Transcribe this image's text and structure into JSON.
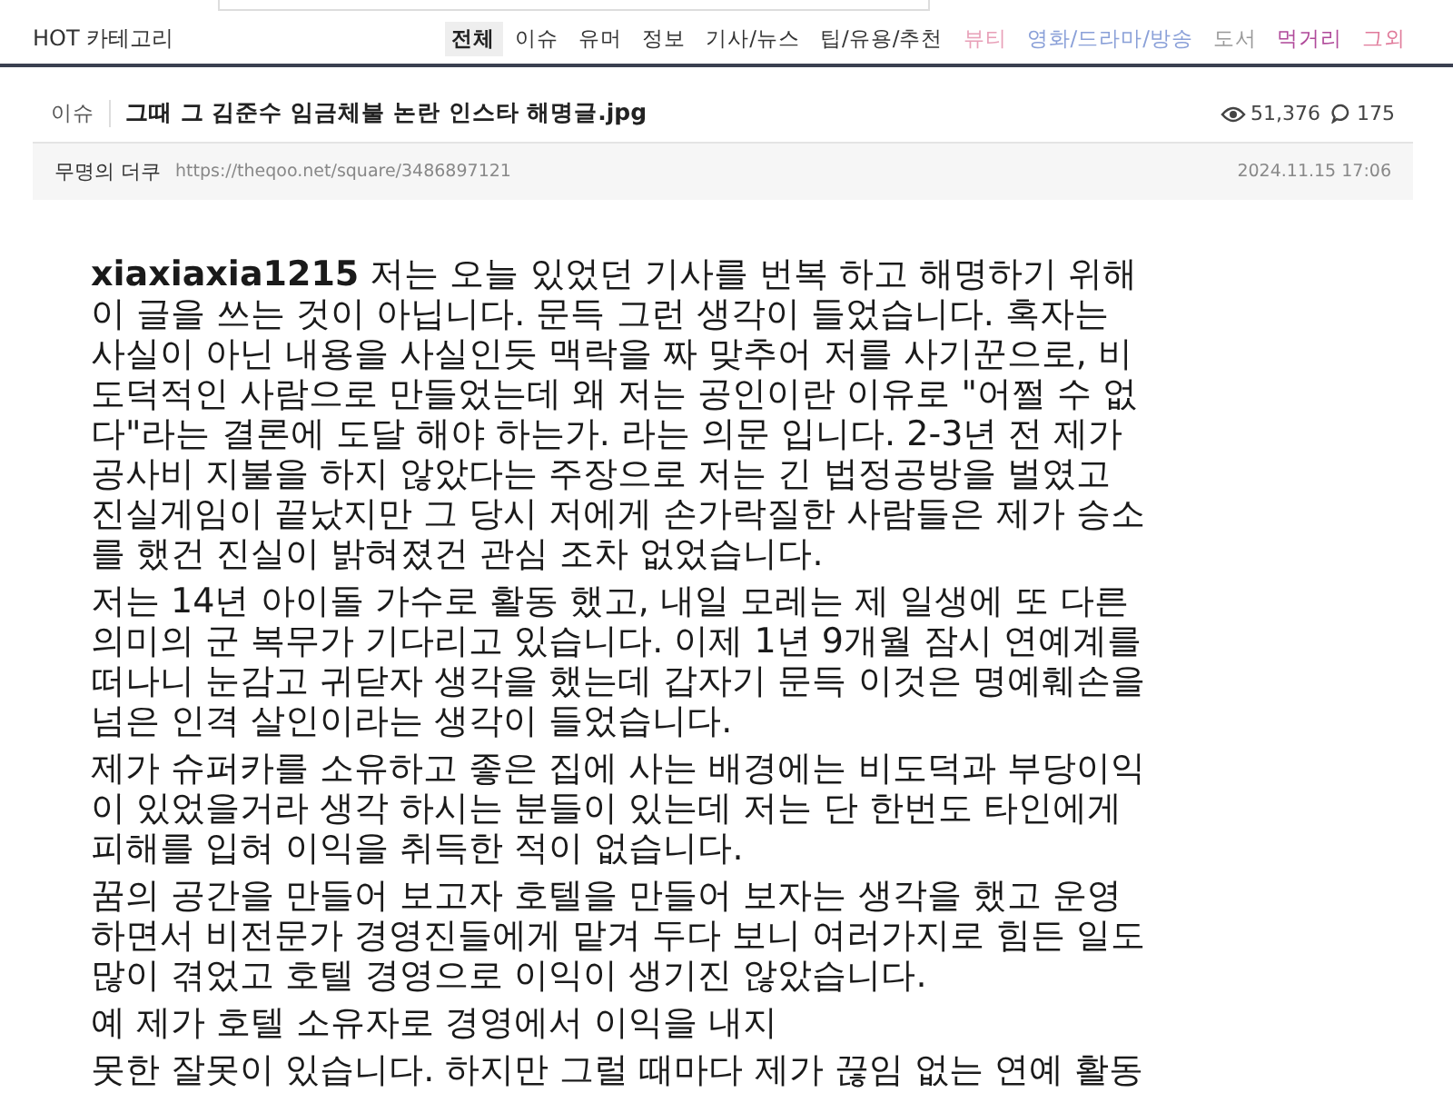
{
  "header": {
    "title": "HOT 카테고리"
  },
  "categories": [
    {
      "label": "전체",
      "selected": true,
      "color": "#222222"
    },
    {
      "label": "이슈",
      "selected": false,
      "color": "#333333"
    },
    {
      "label": "유머",
      "selected": false,
      "color": "#333333"
    },
    {
      "label": "정보",
      "selected": false,
      "color": "#333333"
    },
    {
      "label": "기사/뉴스",
      "selected": false,
      "color": "#333333"
    },
    {
      "label": "팁/유용/추천",
      "selected": false,
      "color": "#333333"
    },
    {
      "label": "뷰티",
      "selected": false,
      "color": "#e8a0b8"
    },
    {
      "label": "영화/드라마/방송",
      "selected": false,
      "color": "#8aa0d8"
    },
    {
      "label": "도서",
      "selected": false,
      "color": "#999999"
    },
    {
      "label": "먹거리",
      "selected": false,
      "color": "#b04a9a"
    },
    {
      "label": "그외",
      "selected": false,
      "color": "#e07a9a"
    }
  ],
  "post": {
    "category": "이슈",
    "title": "그때 그 김준수 임금체불 논란 인스타 해명글.jpg",
    "views": "51,376",
    "comments": "175",
    "author": "무명의 더쿠",
    "url": "https://theqoo.net/square/3486897121",
    "date": "2024.11.15 17:06"
  },
  "body": [
    {
      "lines": [
        "**xiaxiaxia1215** 저는 오늘 있었던 기사를 번복 하고 해명하기 위해",
        "이 글을 쓰는 것이 아닙니다. 문득 그런 생각이 들었습니다. 혹자는",
        "사실이 아닌 내용을 사실인듯 맥락을 짜 맞추어 저를 사기꾼으로, 비",
        "도덕적인 사람으로 만들었는데 왜 저는 공인이란 이유로 \"어쩔 수 없",
        "다\"라는 결론에 도달 해야 하는가. 라는 의문 입니다. 2-3년 전 제가",
        "공사비 지불을 하지 않았다는 주장으로 저는 긴 법정공방을 벌였고",
        "진실게임이 끝났지만 그 당시 저에게 손가락질한 사람들은 제가 승소",
        "를 했건 진실이 밝혀졌건 관심 조차 없었습니다."
      ]
    },
    {
      "lines": [
        "저는 14년 아이돌 가수로 활동 했고, 내일 모레는 제 일생에 또 다른",
        "의미의 군 복무가 기다리고 있습니다. 이제 1년 9개월 잠시 연예계를",
        "떠나니 눈감고 귀닫자 생각을 했는데 갑자기 문득 이것은 명예훼손을",
        "넘은 인격 살인이라는 생각이 들었습니다."
      ]
    },
    {
      "lines": [
        "제가 슈퍼카를 소유하고 좋은 집에 사는 배경에는 비도덕과 부당이익",
        "이 있었을거라 생각 하시는 분들이 있는데 저는 단 한번도 타인에게",
        "피해를 입혀 이익을 취득한 적이 없습니다."
      ]
    },
    {
      "lines": [
        "꿈의 공간을 만들어 보고자 호텔을 만들어 보자는 생각을 했고 운영",
        "하면서 비전문가 경영진들에게 맡겨 두다 보니 여러가지로 힘든 일도",
        "많이 겪었고 호텔 경영으로 이익이 생기진 않았습니다."
      ]
    },
    {
      "lines": [
        "예 제가 호텔 소유자로 경영에서 이익을 내지"
      ]
    },
    {
      "lines": [
        "못한 잘못이 있습니다. 하지만 그럴 때마다 제가 끊임 없는 연예 활동"
      ]
    }
  ]
}
